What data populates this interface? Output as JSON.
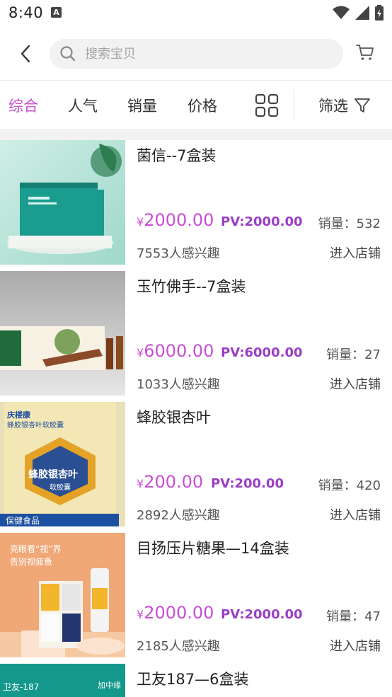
{
  "status_bar": {
    "time": "8:40",
    "notification_label": "A"
  },
  "search": {
    "placeholder": "搜索宝贝"
  },
  "filters": {
    "tabs": [
      {
        "label": "综合",
        "active": true
      },
      {
        "label": "人气",
        "active": false
      },
      {
        "label": "销量",
        "active": false
      },
      {
        "label": "价格",
        "active": false
      }
    ],
    "filter_label": "筛选"
  },
  "colors": {
    "accent": "#c84fd3",
    "pv": "#9a3fc4",
    "band": "#f2f2f2"
  },
  "products": [
    {
      "title": "菌信--7盒装",
      "yen": "¥",
      "price": "2000.00",
      "pv": "PV:2000.00",
      "sales": "销量：532",
      "interest": "7553人感兴趣",
      "enter_shop": "进入店铺"
    },
    {
      "title": "玉竹佛手--7盒装",
      "yen": "¥",
      "price": "6000.00",
      "pv": "PV:6000.00",
      "sales": "销量：27",
      "interest": "1033人感兴趣",
      "enter_shop": "进入店铺"
    },
    {
      "title": "蜂胶银杏叶",
      "yen": "¥",
      "price": "200.00",
      "pv": "PV:200.00",
      "sales": "销量：420",
      "interest": "2892人感兴趣",
      "enter_shop": "进入店铺",
      "image_text": {
        "brand": "庆楼康",
        "product_line": "蜂胶银杏叶软胶囊",
        "badge": "蜂胶银杏叶",
        "badge_sub": "软胶囊",
        "footer": "保健食品"
      }
    },
    {
      "title": "目扬压片糖果—14盒装",
      "yen": "¥",
      "price": "2000.00",
      "pv": "PV:2000.00",
      "sales": "销量：47",
      "interest": "2185人感兴趣",
      "enter_shop": "进入店铺",
      "image_text": {
        "line1": "亮眼看“视”界",
        "line2": "告别视疲惫"
      }
    },
    {
      "title": "卫友187—6盒装",
      "image_text": {
        "label": "卫友-187",
        "brand": "加中缘"
      }
    }
  ]
}
